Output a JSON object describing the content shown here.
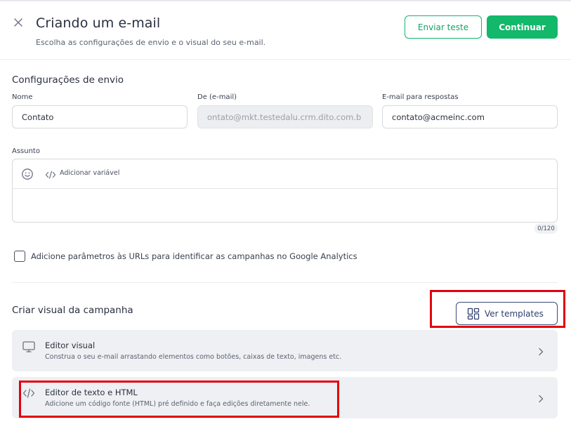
{
  "header": {
    "title": "Criando um e-mail",
    "subtitle": "Escolha as configurações de envio e o visual do seu e-mail.",
    "send_test_label": "Enviar teste",
    "continue_label": "Continuar"
  },
  "send_config": {
    "section_title": "Configurações de envio",
    "name": {
      "label": "Nome",
      "value": "Contato"
    },
    "from": {
      "label": "De (e-mail)",
      "value": "ontato@mkt.testedalu.crm.dito.com.b"
    },
    "reply_to": {
      "label": "E-mail para respostas",
      "value": "contato@acmeinc.com"
    },
    "subject": {
      "label": "Assunto",
      "add_variable_label": "Adicionar variável",
      "value": "",
      "counter": "0/120"
    },
    "analytics_checkbox": {
      "label": "Adicione parâmetros às URLs para identificar as campanhas no Google Analytics",
      "checked": false
    }
  },
  "visual": {
    "section_title": "Criar visual da campanha",
    "templates_button_label": "Ver templates",
    "editors": [
      {
        "name": "Editor visual",
        "description": "Construa o seu e-mail arrastando elementos como botões, caixas de texto, imagens etc.",
        "icon": "monitor-icon"
      },
      {
        "name": "Editor de texto e HTML",
        "description": "Adicione um código fonte (HTML) pré definido e faça edições diretamente nele.",
        "icon": "code-icon"
      }
    ]
  },
  "colors": {
    "primary_green": "#13b86a",
    "navy_outline": "#3b4a7a",
    "highlight_red": "#e3000f"
  }
}
